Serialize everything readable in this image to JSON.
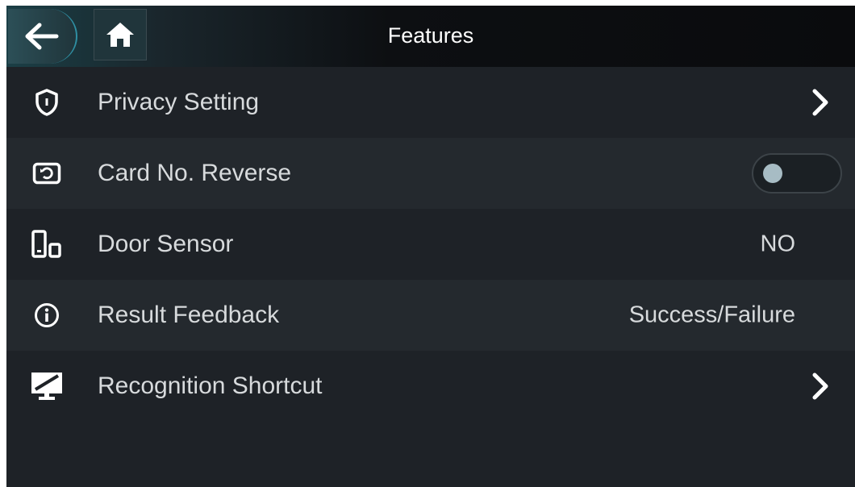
{
  "header": {
    "title": "Features",
    "back_icon": "arrow-left-icon",
    "home_icon": "home-icon"
  },
  "items": [
    {
      "label": "Privacy Setting",
      "icon": "shield-icon",
      "control": "chevron"
    },
    {
      "label": "Card No. Reverse",
      "icon": "card-reverse-icon",
      "control": "toggle",
      "toggle_on": false
    },
    {
      "label": "Door Sensor",
      "icon": "door-sensor-icon",
      "control": "value",
      "value": "NO"
    },
    {
      "label": "Result Feedback",
      "icon": "info-icon",
      "control": "value",
      "value": "Success/Failure"
    },
    {
      "label": "Recognition Shortcut",
      "icon": "monitor-icon",
      "control": "chevron"
    }
  ],
  "colors": {
    "background": "#1e2227",
    "row_alt": "#24292e",
    "accent": "#2f8fa3",
    "text": "#d7dadc"
  }
}
